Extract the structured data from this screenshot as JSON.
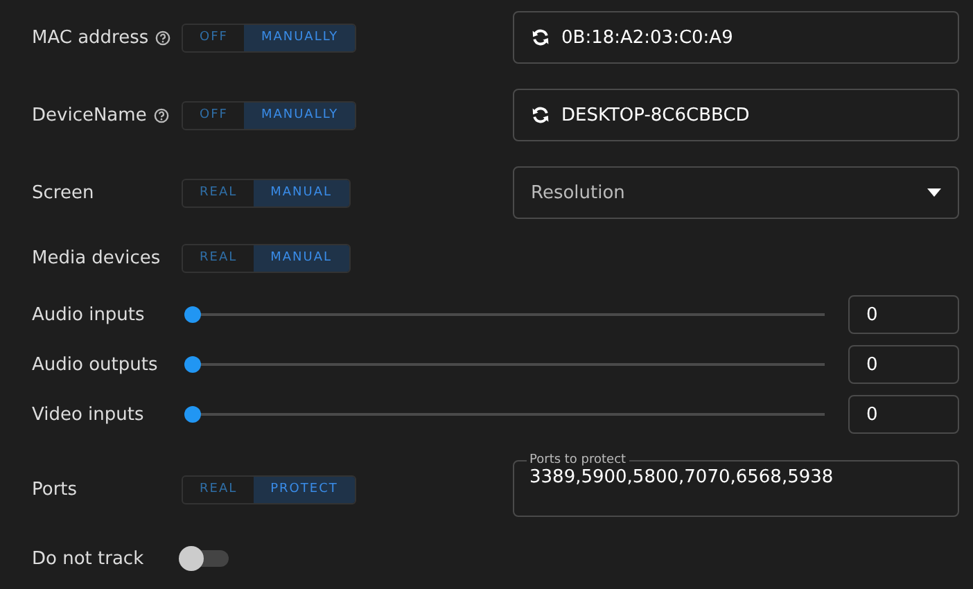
{
  "settings": [
    {
      "kind": "segmented-field",
      "label": "MAC address",
      "help": true,
      "segments": [
        {
          "label": "OFF",
          "selected": false
        },
        {
          "label": "MANUALLY",
          "selected": true
        }
      ],
      "value": "0B:18:A2:03:C0:A9"
    },
    {
      "kind": "segmented-field",
      "label": "DeviceName",
      "help": true,
      "segments": [
        {
          "label": "OFF",
          "selected": false
        },
        {
          "label": "MANUALLY",
          "selected": true
        }
      ],
      "value": "DESKTOP-8C6CBBCD"
    },
    {
      "kind": "segmented-select",
      "label": "Screen",
      "help": false,
      "segments": [
        {
          "label": "REAL",
          "selected": false
        },
        {
          "label": "MANUAL",
          "selected": true
        }
      ],
      "placeholder": "Resolution"
    },
    {
      "kind": "segmented",
      "label": "Media devices",
      "help": false,
      "segments": [
        {
          "label": "REAL",
          "selected": false
        },
        {
          "label": "MANUAL",
          "selected": true
        }
      ]
    },
    {
      "kind": "slider",
      "label": "Audio inputs",
      "level": 0,
      "value": "0"
    },
    {
      "kind": "slider",
      "label": "Audio outputs",
      "level": 0,
      "value": "0"
    },
    {
      "kind": "slider",
      "label": "Video inputs",
      "level": 0,
      "value": "0"
    },
    {
      "kind": "segmented-ports",
      "label": "Ports",
      "help": false,
      "segments": [
        {
          "label": "REAL",
          "selected": false
        },
        {
          "label": "PROTECT",
          "selected": true
        }
      ],
      "field_label": "Ports to protect",
      "value": "3389,5900,5800,7070,6568,5938"
    },
    {
      "kind": "switch",
      "label": "Do not track",
      "on": false
    }
  ]
}
